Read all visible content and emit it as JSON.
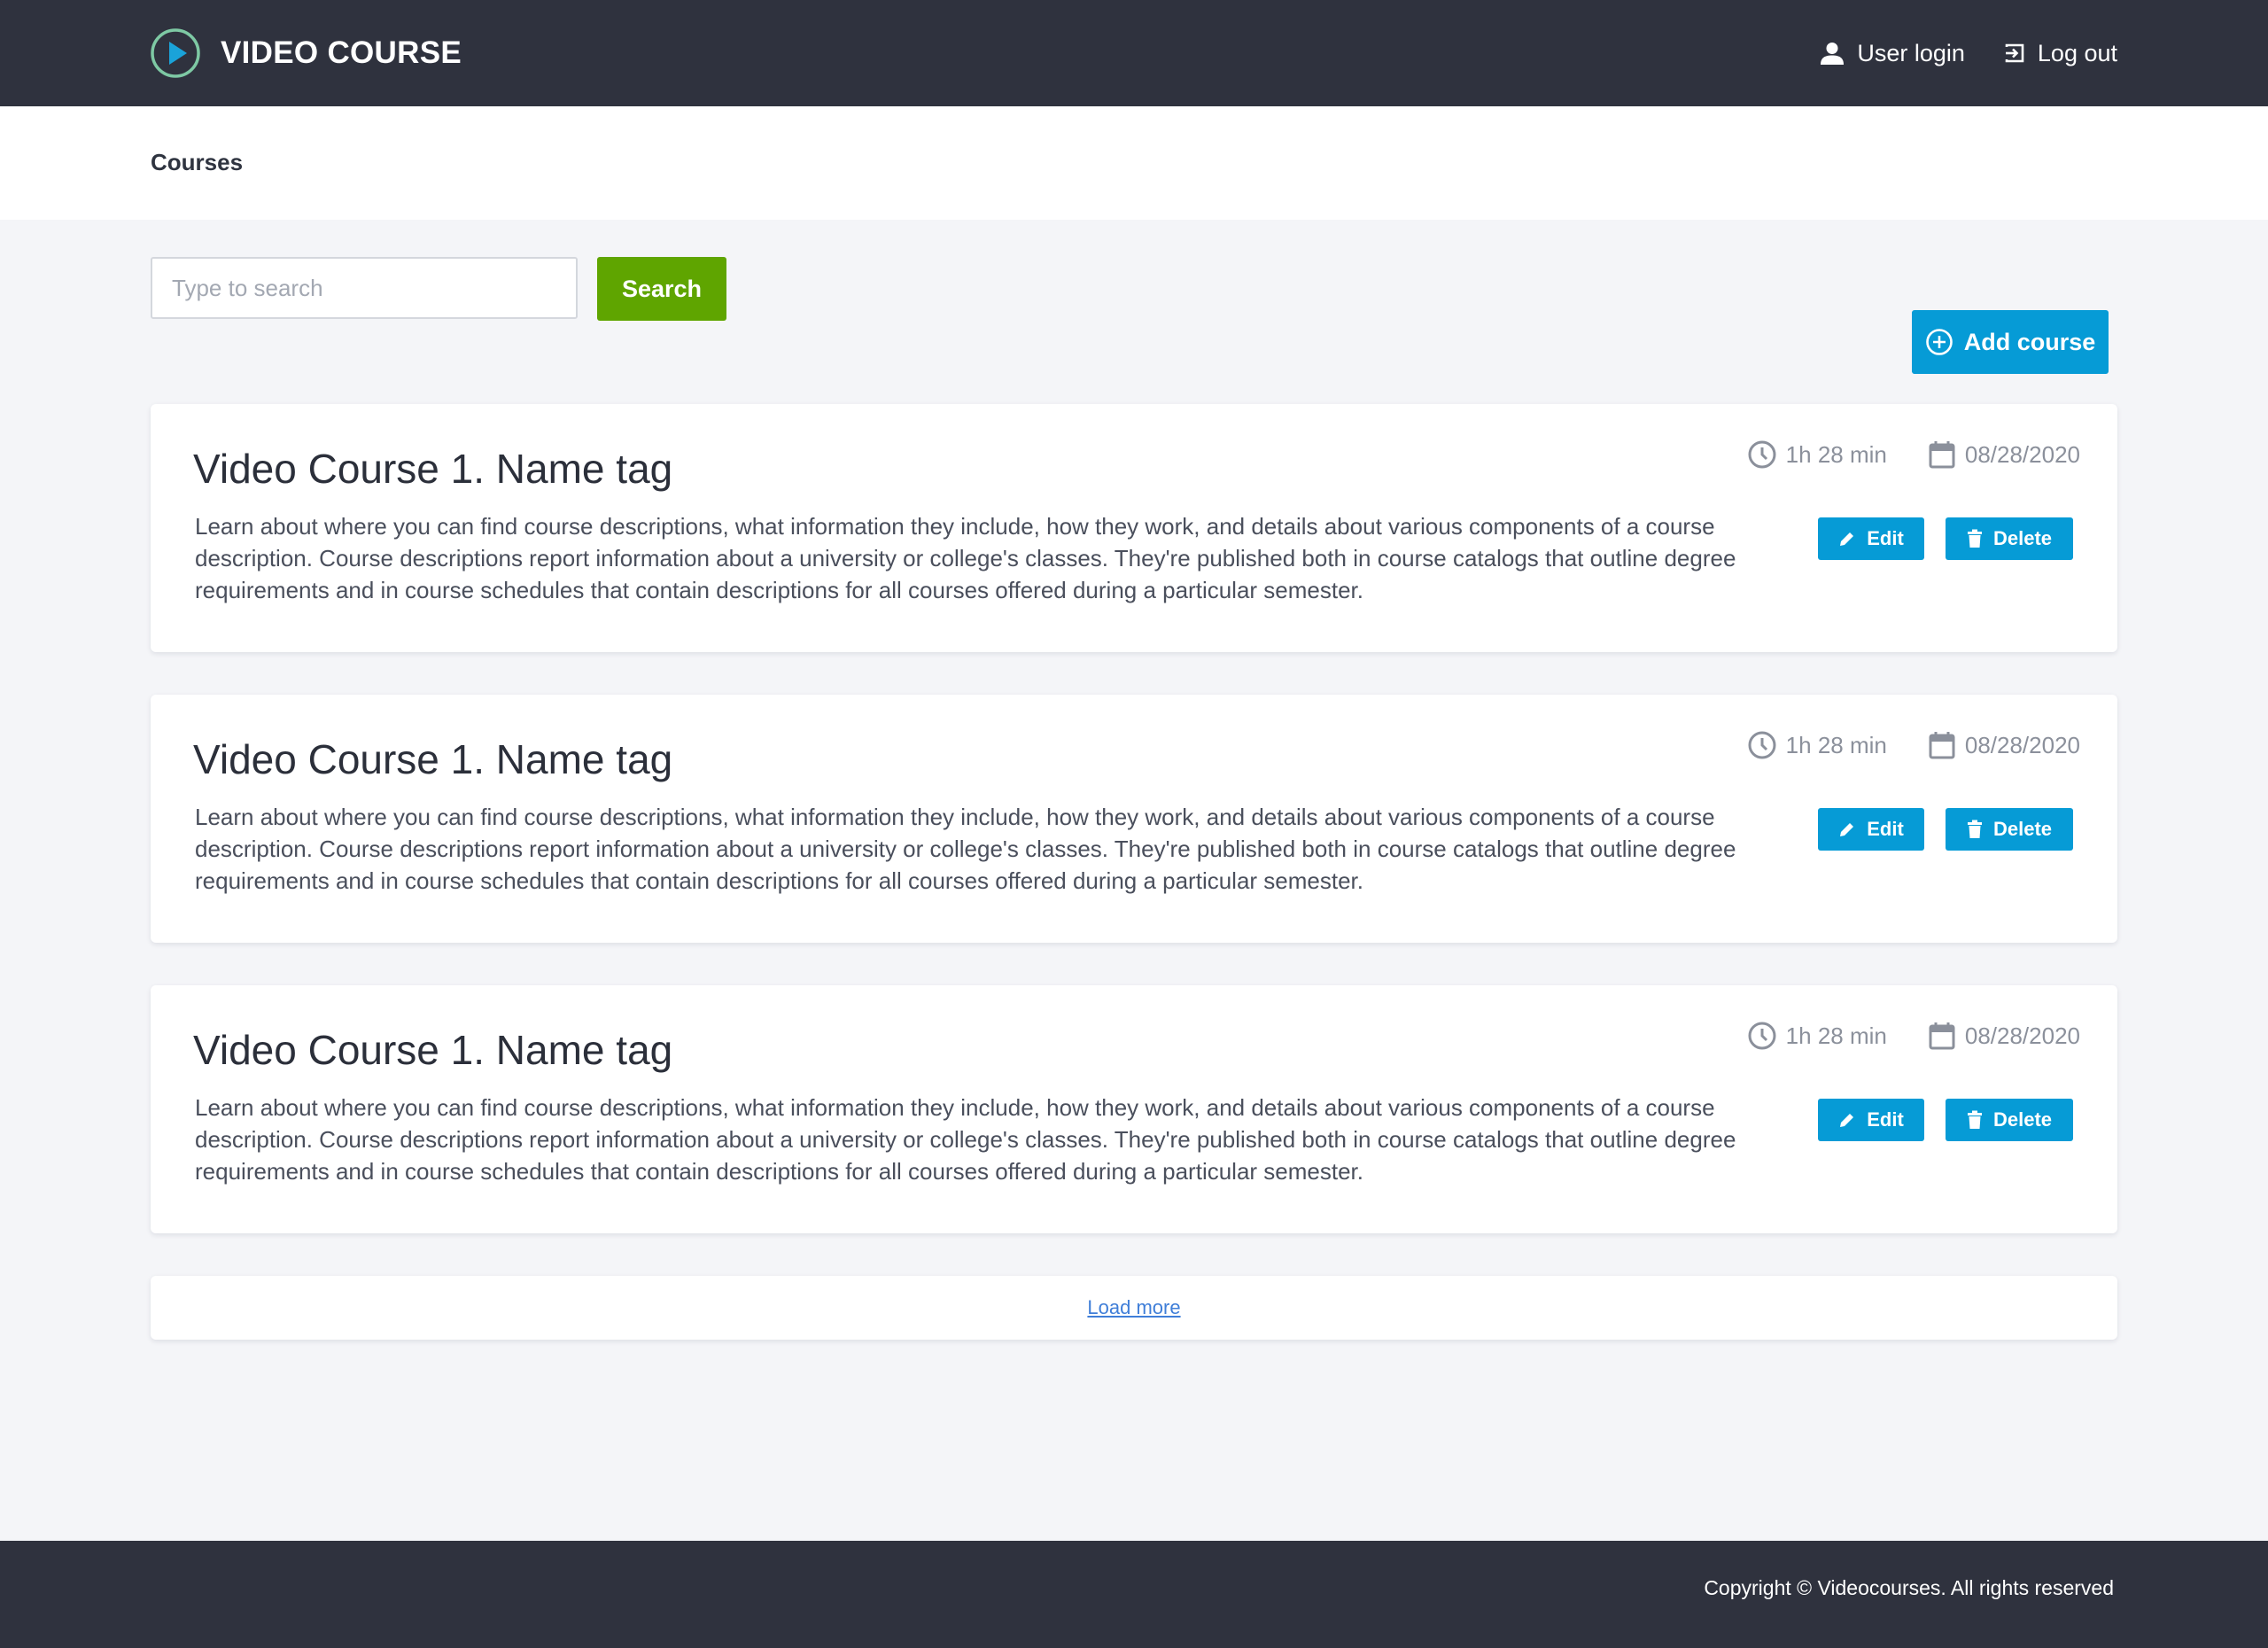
{
  "header": {
    "brand_title": "VIDEO COURSE",
    "user_login_label": "User login",
    "logout_label": "Log out"
  },
  "breadcrumb": {
    "current": "Courses"
  },
  "search": {
    "placeholder": "Type to search",
    "value": "",
    "button_label": "Search"
  },
  "toolbar": {
    "add_course_label": "Add course"
  },
  "courses": [
    {
      "title": "Video Course 1. Name tag",
      "description": "Learn about where you can find course descriptions, what information they include, how they work, and details about various components of a course description. Course descriptions report information about a university or college's classes. They're published both in course catalogs that outline degree requirements and in course schedules that contain descriptions for all courses offered during a particular semester.",
      "duration": "1h 28 min",
      "date": "08/28/2020",
      "edit_label": "Edit",
      "delete_label": "Delete"
    },
    {
      "title": "Video Course 1. Name tag",
      "description": "Learn about where you can find course descriptions, what information they include, how they work, and details about various components of a course description. Course descriptions report information about a university or college's classes. They're published both in course catalogs that outline degree requirements and in course schedules that contain descriptions for all courses offered during a particular semester.",
      "duration": "1h 28 min",
      "date": "08/28/2020",
      "edit_label": "Edit",
      "delete_label": "Delete"
    },
    {
      "title": "Video Course 1. Name tag",
      "description": "Learn about where you can find course descriptions, what information they include, how they work, and details about various components of a course description. Course descriptions report information about a university or college's classes. They're published both in course catalogs that outline degree requirements and in course schedules that contain descriptions for all courses offered during a particular semester.",
      "duration": "1h 28 min",
      "date": "08/28/2020",
      "edit_label": "Edit",
      "delete_label": "Delete"
    }
  ],
  "pagination": {
    "load_more_label": "Load more"
  },
  "footer": {
    "copyright": "Copyright © Videocourses. All rights reserved"
  },
  "icons": {
    "brand": "play-circle-icon",
    "user_login": "user-icon",
    "logout": "logout-icon",
    "add_course": "plus-circle-icon",
    "duration": "clock-icon",
    "date": "calendar-icon",
    "edit": "pencil-icon",
    "delete": "trash-icon"
  },
  "colors": {
    "header_bg": "#2f323e",
    "page_bg": "#f4f5f8",
    "search_button": "#5fa500",
    "primary_button": "#069bd6",
    "link": "#3f7ed8",
    "logo_ring": "#7ec9a4",
    "logo_play": "#1aa3d9"
  }
}
